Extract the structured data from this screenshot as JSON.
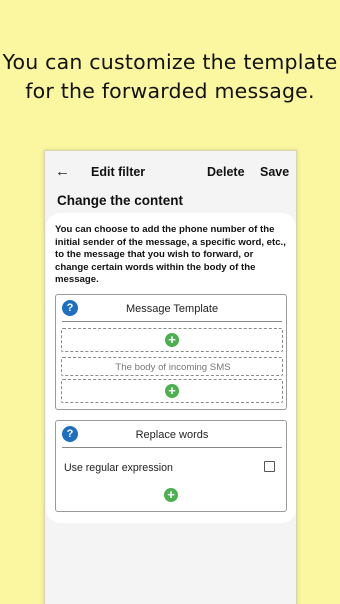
{
  "promo": {
    "line1": "You can customize the template",
    "line2": "for the forwarded message."
  },
  "appbar": {
    "back_icon": "←",
    "title": "Edit filter",
    "delete_label": "Delete",
    "save_label": "Save"
  },
  "section_title": "Change the content",
  "description": "You can choose to add the phone number of the initial sender of the message, a specific word, etc., to the message that you wish to forward, or change certain words within the body of the message.",
  "template_panel": {
    "help_icon": "?",
    "title": "Message Template",
    "add_icon": "+",
    "body_placeholder": "The body of incoming SMS"
  },
  "replace_panel": {
    "help_icon": "?",
    "title": "Replace words",
    "regex_label": "Use regular expression",
    "regex_checked": false,
    "add_icon": "+"
  },
  "colors": {
    "background": "#fbf7a0",
    "help_blue": "#1f6fc0",
    "add_green": "#4caf50"
  }
}
